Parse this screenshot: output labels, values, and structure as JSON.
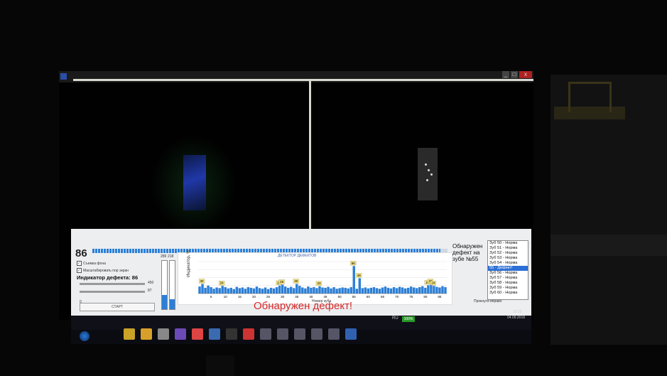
{
  "window": {
    "title": "",
    "buttons": {
      "minimize": "_",
      "maximize": "□",
      "close": "x"
    }
  },
  "panel": {
    "top_number": "86",
    "overall_progress": 0.98,
    "checkboxes": [
      {
        "label": "Съемка фона",
        "checked": true
      },
      {
        "label": "Масштабировать пор экран",
        "checked": true
      }
    ],
    "indicator_label": "Индикатор дефекта: 86",
    "sliders": [
      {
        "value": "450",
        "level": 0.5
      },
      {
        "value": "87",
        "level": 0.35
      }
    ],
    "small_zero": "0",
    "start_button": "СТАРТ",
    "gauges": [
      {
        "label": "289",
        "level": 0.3
      },
      {
        "label": "218",
        "level": 0.2
      }
    ],
    "alert": "Обнаружен дефект!",
    "detection_text": "Обнаружен дефект на зубе №55",
    "teeth_list": [
      {
        "label": "Зуб 50 - Норма",
        "selected": false
      },
      {
        "label": "Зуб 51 - Норма",
        "selected": false
      },
      {
        "label": "Зуб 52 - Норма",
        "selected": false
      },
      {
        "label": "Зуб 53 - Норма",
        "selected": false
      },
      {
        "label": "Зуб 54 - Норма",
        "selected": false
      },
      {
        "label": "55 - Дефект!",
        "selected": true
      },
      {
        "label": "Зуб 56 - Норма",
        "selected": false
      },
      {
        "label": "Зуб 57 - Норма",
        "selected": false
      },
      {
        "label": "Зуб 58 - Норма",
        "selected": false
      },
      {
        "label": "Зуб 59 - Норма",
        "selected": false
      },
      {
        "label": "Зуб 60 - Норма",
        "selected": false
      }
    ],
    "save_link": "Прокнути вправо"
  },
  "chart_data": {
    "type": "bar",
    "title": "ДЕТЕКТОР ДЕФЕКТОВ",
    "xlabel": "Номер зуба",
    "ylabel": "Индикатор, %",
    "ylim": [
      0,
      100
    ],
    "x_ticks": [
      5,
      10,
      15,
      20,
      25,
      30,
      35,
      40,
      45,
      50,
      55,
      60,
      65,
      70,
      75,
      80,
      85
    ],
    "x": [
      1,
      2,
      3,
      4,
      5,
      6,
      7,
      8,
      9,
      10,
      11,
      12,
      13,
      14,
      15,
      16,
      17,
      18,
      19,
      20,
      21,
      22,
      23,
      24,
      25,
      26,
      27,
      28,
      29,
      30,
      31,
      32,
      33,
      34,
      35,
      36,
      37,
      38,
      39,
      40,
      41,
      42,
      43,
      44,
      45,
      46,
      47,
      48,
      49,
      50,
      51,
      52,
      53,
      54,
      55,
      56,
      57,
      58,
      59,
      60,
      61,
      62,
      63,
      64,
      65,
      66,
      67,
      68,
      69,
      70,
      71,
      72,
      73,
      74,
      75,
      76,
      77,
      78,
      79,
      80,
      81,
      82,
      83,
      84,
      85,
      86,
      87
    ],
    "values": [
      22,
      30,
      18,
      25,
      20,
      15,
      19,
      17,
      24,
      20,
      16,
      18,
      14,
      21,
      17,
      19,
      15,
      20,
      18,
      16,
      22,
      17,
      15,
      19,
      14,
      18,
      16,
      20,
      25,
      28,
      22,
      18,
      21,
      17,
      30,
      24,
      19,
      16,
      22,
      18,
      20,
      17,
      23,
      19,
      18,
      21,
      16,
      20,
      15,
      17,
      19,
      18,
      16,
      20,
      86,
      15,
      48,
      17,
      19,
      16,
      18,
      20,
      17,
      15,
      19,
      22,
      18,
      16,
      20,
      17,
      21,
      19,
      16,
      18,
      22,
      19,
      17,
      20,
      23,
      18,
      26,
      30,
      24,
      21,
      19,
      23,
      20
    ],
    "labels": [
      "",
      "30",
      "",
      "",
      "",
      "",
      "",
      "",
      "24",
      "",
      "",
      "",
      "",
      "",
      "",
      "",
      "",
      "",
      "",
      "",
      "",
      "",
      "",
      "",
      "",
      "",
      "",
      "",
      "25",
      "28",
      "",
      "",
      "",
      "",
      "30",
      "",
      "",
      "",
      "",
      "",
      "",
      "",
      "23",
      "",
      "",
      "",
      "",
      "",
      "",
      "",
      "",
      "",
      "",
      "",
      "86",
      "",
      "48",
      "",
      "",
      "",
      "",
      "",
      "",
      "",
      "",
      "",
      "",
      "",
      "",
      "",
      "",
      "",
      "",
      "",
      "",
      "",
      "",
      "",
      "",
      "",
      "26",
      "30",
      "24",
      "",
      "",
      "",
      ""
    ]
  },
  "taskbar": {
    "language": "RU",
    "battery": "100%",
    "time": "16:22",
    "date": "04.09.2018",
    "icons": [
      "folder-icon",
      "media-player-icon",
      "app-icon",
      "viber-icon",
      "chrome-icon",
      "explorer-icon",
      "terminal-icon",
      "app-icon",
      "window-icon",
      "window-icon",
      "window-icon",
      "window-icon",
      "window-icon",
      "network-app-icon"
    ]
  }
}
